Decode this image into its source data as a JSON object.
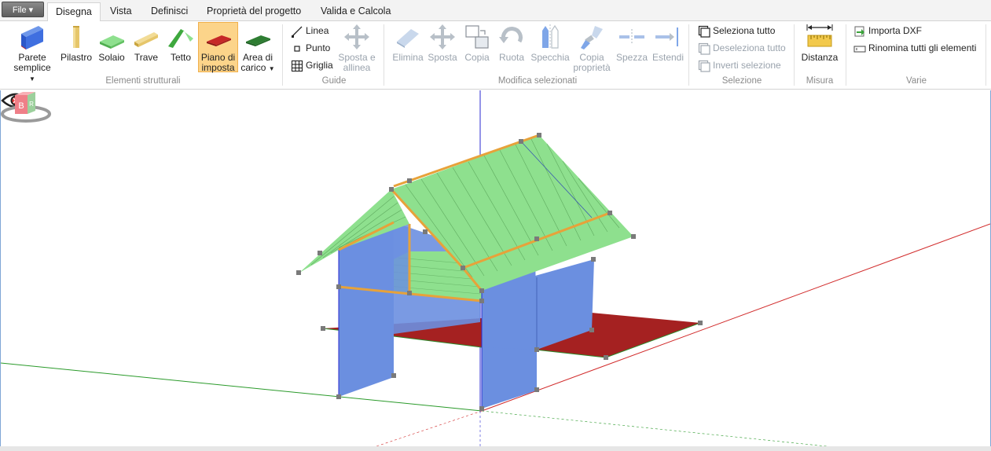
{
  "menu": {
    "file_label": "File"
  },
  "tabs": [
    {
      "label": "Disegna",
      "active": true
    },
    {
      "label": "Vista"
    },
    {
      "label": "Definisci"
    },
    {
      "label": "Proprietà del progetto"
    },
    {
      "label": "Valida e Calcola"
    }
  ],
  "groups": {
    "strutturali": {
      "label": "Elementi strutturali",
      "parete_1": "Parete",
      "parete_2": "semplice",
      "pilastro": "Pilastro",
      "solaio": "Solaio",
      "trave": "Trave",
      "tetto": "Tetto",
      "piano_1": "Piano di",
      "piano_2": "imposta",
      "area_1": "Area di",
      "area_2": "carico"
    },
    "guide": {
      "label": "Guide",
      "linea": "Linea",
      "punto": "Punto",
      "griglia": "Griglia",
      "sposta_1": "Sposta e",
      "sposta_2": "allinea"
    },
    "modifica": {
      "label": "Modifica selezionati",
      "elimina": "Elimina",
      "sposta": "Sposta",
      "copia": "Copia",
      "ruota": "Ruota",
      "specchia": "Specchia",
      "copia_prop_1": "Copia",
      "copia_prop_2": "proprietà",
      "spezza": "Spezza",
      "estendi": "Estendi"
    },
    "selezione": {
      "label": "Selezione",
      "seleziona": "Seleziona tutto",
      "deseleziona": "Deseleziona tutto",
      "inverti": "Inverti selezione"
    },
    "misura": {
      "label": "Misura",
      "distanza": "Distanza"
    },
    "varie": {
      "label": "Varie",
      "importa": "Importa DXF",
      "rinomina": "Rinomina tutti gli elementi"
    }
  },
  "viewport": {
    "nav_cube_faces": [
      "B",
      "R"
    ],
    "colors": {
      "wall": "#6b8fe0",
      "roof": "#8ee08e",
      "base": "#a52121",
      "beam": "#e7a23a",
      "axis_x": "#d12a2a",
      "axis_y": "#2a9a2a",
      "axis_z": "#2a2ad1"
    }
  }
}
